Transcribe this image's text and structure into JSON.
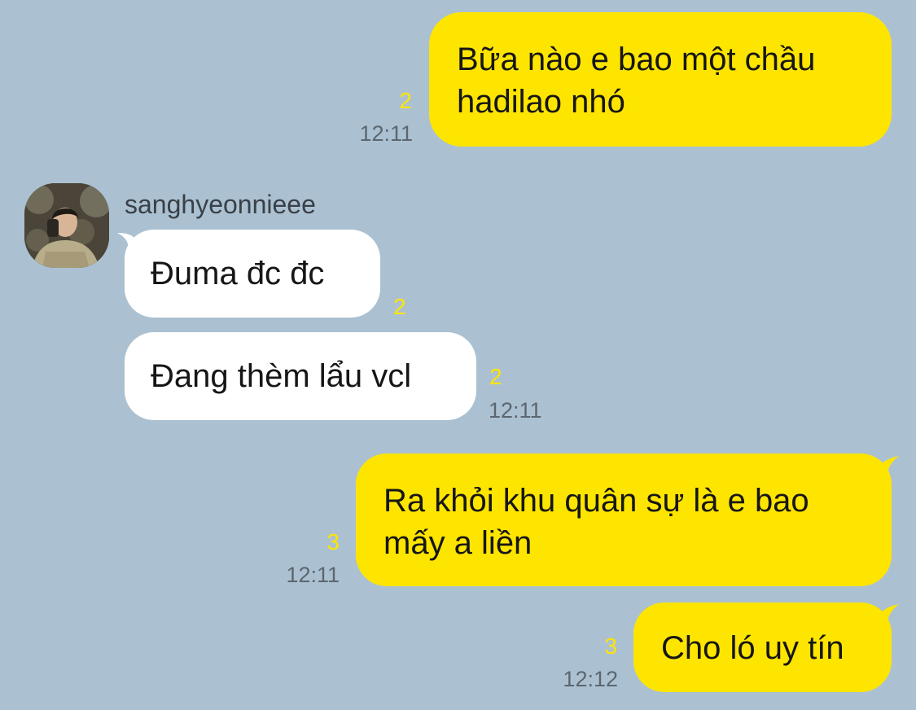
{
  "chat": {
    "contact_name": "sanghyeonnieee",
    "messages": [
      {
        "direction": "out",
        "text": "Bữa nào e bao một chầu\nhadilao nhó",
        "unread": "2",
        "time": "12:11"
      },
      {
        "direction": "in",
        "text": "Đuma đc đc",
        "unread": "2",
        "time": ""
      },
      {
        "direction": "in",
        "text": "Đang thèm lẩu vcl",
        "unread": "2",
        "time": "12:11"
      },
      {
        "direction": "out",
        "text": "Ra khỏi khu quân sự là e bao\nmấy a liền",
        "unread": "3",
        "time": "12:11"
      },
      {
        "direction": "out",
        "text": "Cho ló uy tín",
        "unread": "3",
        "time": "12:12"
      }
    ]
  },
  "colors": {
    "background": "#abc1d1",
    "outgoing_bubble": "#fee500",
    "incoming_bubble": "#ffffff",
    "unread_count": "#fee500",
    "timestamp": "#5c6670"
  },
  "icons": {
    "avatar": "profile-photo"
  }
}
